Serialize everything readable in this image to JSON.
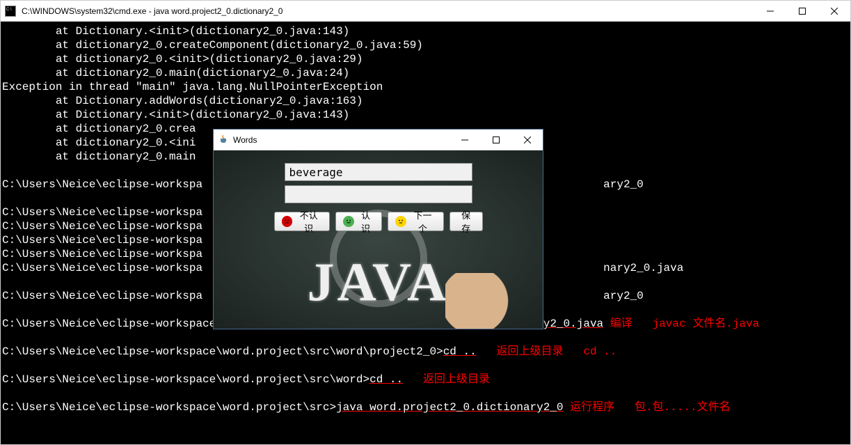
{
  "console": {
    "title": "C:\\WINDOWS\\system32\\cmd.exe - java  word.project2_0.dictionary2_0",
    "lines": [
      "        at Dictionary.<init>(dictionary2_0.java:143)",
      "        at dictionary2_0.createComponent(dictionary2_0.java:59)",
      "        at dictionary2_0.<init>(dictionary2_0.java:29)",
      "        at dictionary2_0.main(dictionary2_0.java:24)",
      "Exception in thread \"main\" java.lang.NullPointerException",
      "        at Dictionary.addWords(dictionary2_0.java:163)",
      "        at Dictionary.<init>(dictionary2_0.java:143)",
      "        at dictionary2_0.crea",
      "        at dictionary2_0.<ini",
      "        at dictionary2_0.main",
      "",
      "C:\\Users\\Neice\\eclipse-workspa",
      "",
      "C:\\Users\\Neice\\eclipse-workspa",
      "C:\\Users\\Neice\\eclipse-workspa",
      "C:\\Users\\Neice\\eclipse-workspa",
      "C:\\Users\\Neice\\eclipse-workspa",
      "C:\\Users\\Neice\\eclipse-workspa",
      "",
      "C:\\Users\\Neice\\eclipse-workspa"
    ],
    "tail_text": {
      "t1": "ary2_0",
      "t2": "nary2_0.java",
      "t3": "ary2_0"
    },
    "full_prompts": {
      "p1_path": "C:\\Users\\Neice\\eclipse-workspace\\word.project\\src\\word\\project2_0>",
      "p1_cmd": "javac dictionary2_0.java",
      "p1_note1": "编译",
      "p1_note2": "javac 文件名.java",
      "p2_path": "C:\\Users\\Neice\\eclipse-workspace\\word.project\\src\\word\\project2_0>",
      "p2_cmd": "cd ..",
      "p2_note1": "返回上级目录",
      "p2_note2": "cd ..",
      "p3_path": "C:\\Users\\Neice\\eclipse-workspace\\word.project\\src\\word>",
      "p3_cmd": "cd ..",
      "p3_note1": "返回上级目录",
      "p4_path": "C:\\Users\\Neice\\eclipse-workspace\\word.project\\src>",
      "p4_cmd": "java word.project2_0.dictionary2_0",
      "p4_note1": "运行程序",
      "p4_note2": "包.包.....文件名"
    }
  },
  "java_window": {
    "title": "Words",
    "input_value": "beverage",
    "input2_value": "",
    "buttons": {
      "dont_know": "不认识",
      "know": "认识",
      "next": "下一个",
      "save": "保存"
    },
    "chalk_text": "JAVA"
  }
}
